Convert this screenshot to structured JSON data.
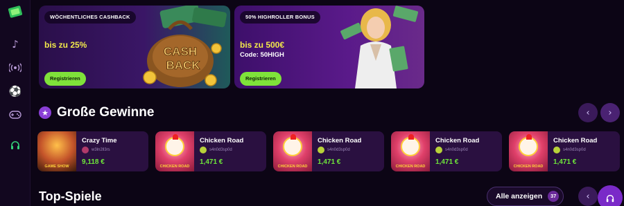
{
  "banners": [
    {
      "tag": "WÖCHENTLICHES CASHBACK",
      "amount": "bis zu 25%",
      "code": "",
      "button": "Registrieren",
      "art_text_1": "CASH",
      "art_text_2": "BACK"
    },
    {
      "tag": "50% HIGHROLLER BONUS",
      "amount": "bis zu 500€",
      "code": "Code: 50HIGH",
      "button": "Registrieren"
    }
  ],
  "big_wins": {
    "title": "Große Gewinne",
    "cards": [
      {
        "game": "Crazy Time",
        "user": "w3ln2ll3rs",
        "amount": "9,118 €",
        "thumb_label": "GAME SHOW"
      },
      {
        "game": "Chicken Road",
        "user": "s4n0d3sp0d",
        "amount": "1,471 €",
        "thumb_label": "CHICKEN ROAD"
      },
      {
        "game": "Chicken Road",
        "user": "s4n0d3sp0d",
        "amount": "1,471 €",
        "thumb_label": "CHICKEN ROAD"
      },
      {
        "game": "Chicken Road",
        "user": "s4n0d3sp0d",
        "amount": "1,471 €",
        "thumb_label": "CHICKEN ROAD"
      },
      {
        "game": "Chicken Road",
        "user": "s4n0d3sp0d",
        "amount": "1,471 €",
        "thumb_label": "CHICKEN ROAD"
      }
    ]
  },
  "top_games": {
    "title": "Top-Spiele",
    "show_all": "Alle anzeigen",
    "count": "37"
  },
  "icons": {
    "logo": "casino-logo-icon",
    "music": "music-icon",
    "live": "live-broadcast-icon",
    "sports": "soccer-ball-icon",
    "games": "gamepad-icon",
    "support": "headset-icon",
    "prev": "chevron-left-icon",
    "next": "chevron-right-icon",
    "trophy": "star-badge-icon"
  },
  "colors": {
    "accent_green": "#7fe23a",
    "win_green": "#6fe83a",
    "amount_yellow": "#f2e94a",
    "purple": "#7a2ac8"
  }
}
